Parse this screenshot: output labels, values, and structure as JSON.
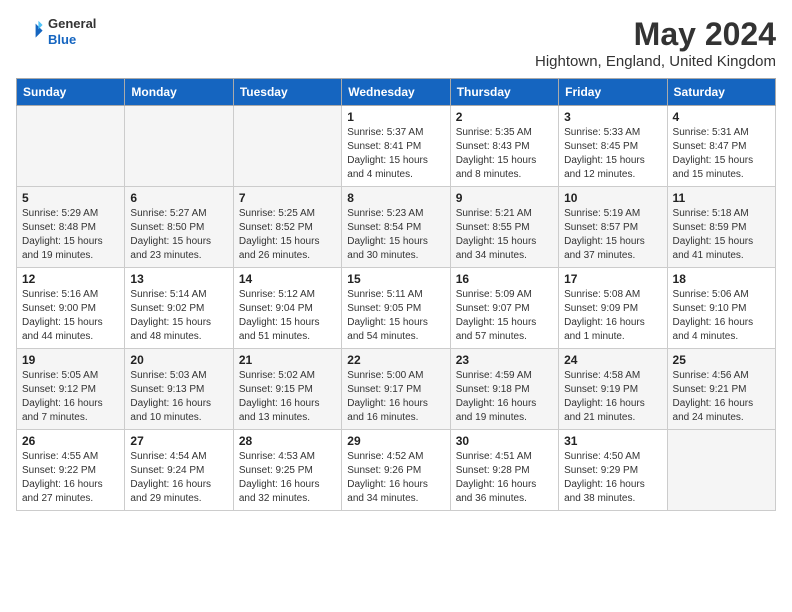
{
  "header": {
    "logo_general": "General",
    "logo_blue": "Blue",
    "month_title": "May 2024",
    "location": "Hightown, England, United Kingdom"
  },
  "weekdays": [
    "Sunday",
    "Monday",
    "Tuesday",
    "Wednesday",
    "Thursday",
    "Friday",
    "Saturday"
  ],
  "weeks": [
    [
      {
        "day": "",
        "info": ""
      },
      {
        "day": "",
        "info": ""
      },
      {
        "day": "",
        "info": ""
      },
      {
        "day": "1",
        "info": "Sunrise: 5:37 AM\nSunset: 8:41 PM\nDaylight: 15 hours\nand 4 minutes."
      },
      {
        "day": "2",
        "info": "Sunrise: 5:35 AM\nSunset: 8:43 PM\nDaylight: 15 hours\nand 8 minutes."
      },
      {
        "day": "3",
        "info": "Sunrise: 5:33 AM\nSunset: 8:45 PM\nDaylight: 15 hours\nand 12 minutes."
      },
      {
        "day": "4",
        "info": "Sunrise: 5:31 AM\nSunset: 8:47 PM\nDaylight: 15 hours\nand 15 minutes."
      }
    ],
    [
      {
        "day": "5",
        "info": "Sunrise: 5:29 AM\nSunset: 8:48 PM\nDaylight: 15 hours\nand 19 minutes."
      },
      {
        "day": "6",
        "info": "Sunrise: 5:27 AM\nSunset: 8:50 PM\nDaylight: 15 hours\nand 23 minutes."
      },
      {
        "day": "7",
        "info": "Sunrise: 5:25 AM\nSunset: 8:52 PM\nDaylight: 15 hours\nand 26 minutes."
      },
      {
        "day": "8",
        "info": "Sunrise: 5:23 AM\nSunset: 8:54 PM\nDaylight: 15 hours\nand 30 minutes."
      },
      {
        "day": "9",
        "info": "Sunrise: 5:21 AM\nSunset: 8:55 PM\nDaylight: 15 hours\nand 34 minutes."
      },
      {
        "day": "10",
        "info": "Sunrise: 5:19 AM\nSunset: 8:57 PM\nDaylight: 15 hours\nand 37 minutes."
      },
      {
        "day": "11",
        "info": "Sunrise: 5:18 AM\nSunset: 8:59 PM\nDaylight: 15 hours\nand 41 minutes."
      }
    ],
    [
      {
        "day": "12",
        "info": "Sunrise: 5:16 AM\nSunset: 9:00 PM\nDaylight: 15 hours\nand 44 minutes."
      },
      {
        "day": "13",
        "info": "Sunrise: 5:14 AM\nSunset: 9:02 PM\nDaylight: 15 hours\nand 48 minutes."
      },
      {
        "day": "14",
        "info": "Sunrise: 5:12 AM\nSunset: 9:04 PM\nDaylight: 15 hours\nand 51 minutes."
      },
      {
        "day": "15",
        "info": "Sunrise: 5:11 AM\nSunset: 9:05 PM\nDaylight: 15 hours\nand 54 minutes."
      },
      {
        "day": "16",
        "info": "Sunrise: 5:09 AM\nSunset: 9:07 PM\nDaylight: 15 hours\nand 57 minutes."
      },
      {
        "day": "17",
        "info": "Sunrise: 5:08 AM\nSunset: 9:09 PM\nDaylight: 16 hours\nand 1 minute."
      },
      {
        "day": "18",
        "info": "Sunrise: 5:06 AM\nSunset: 9:10 PM\nDaylight: 16 hours\nand 4 minutes."
      }
    ],
    [
      {
        "day": "19",
        "info": "Sunrise: 5:05 AM\nSunset: 9:12 PM\nDaylight: 16 hours\nand 7 minutes."
      },
      {
        "day": "20",
        "info": "Sunrise: 5:03 AM\nSunset: 9:13 PM\nDaylight: 16 hours\nand 10 minutes."
      },
      {
        "day": "21",
        "info": "Sunrise: 5:02 AM\nSunset: 9:15 PM\nDaylight: 16 hours\nand 13 minutes."
      },
      {
        "day": "22",
        "info": "Sunrise: 5:00 AM\nSunset: 9:17 PM\nDaylight: 16 hours\nand 16 minutes."
      },
      {
        "day": "23",
        "info": "Sunrise: 4:59 AM\nSunset: 9:18 PM\nDaylight: 16 hours\nand 19 minutes."
      },
      {
        "day": "24",
        "info": "Sunrise: 4:58 AM\nSunset: 9:19 PM\nDaylight: 16 hours\nand 21 minutes."
      },
      {
        "day": "25",
        "info": "Sunrise: 4:56 AM\nSunset: 9:21 PM\nDaylight: 16 hours\nand 24 minutes."
      }
    ],
    [
      {
        "day": "26",
        "info": "Sunrise: 4:55 AM\nSunset: 9:22 PM\nDaylight: 16 hours\nand 27 minutes."
      },
      {
        "day": "27",
        "info": "Sunrise: 4:54 AM\nSunset: 9:24 PM\nDaylight: 16 hours\nand 29 minutes."
      },
      {
        "day": "28",
        "info": "Sunrise: 4:53 AM\nSunset: 9:25 PM\nDaylight: 16 hours\nand 32 minutes."
      },
      {
        "day": "29",
        "info": "Sunrise: 4:52 AM\nSunset: 9:26 PM\nDaylight: 16 hours\nand 34 minutes."
      },
      {
        "day": "30",
        "info": "Sunrise: 4:51 AM\nSunset: 9:28 PM\nDaylight: 16 hours\nand 36 minutes."
      },
      {
        "day": "31",
        "info": "Sunrise: 4:50 AM\nSunset: 9:29 PM\nDaylight: 16 hours\nand 38 minutes."
      },
      {
        "day": "",
        "info": ""
      }
    ]
  ]
}
